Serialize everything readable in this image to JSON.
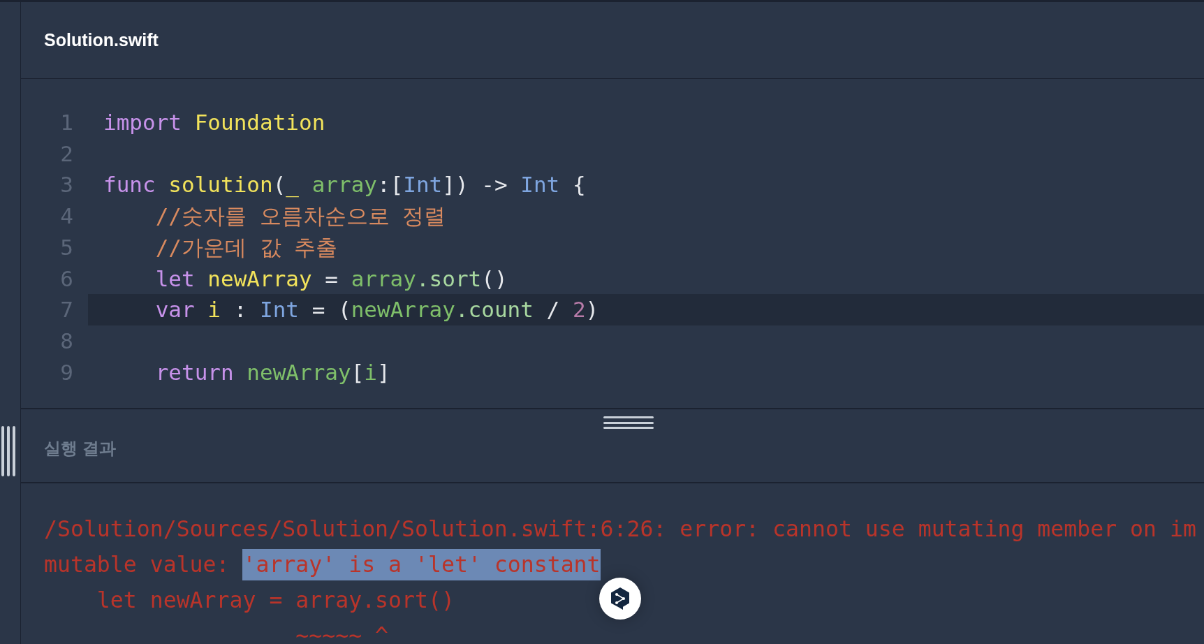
{
  "editor": {
    "file_title": "Solution.swift",
    "lines": [
      {
        "number": "1",
        "current": false,
        "tokens": [
          {
            "text": "import ",
            "kind": "keyword"
          },
          {
            "text": "Foundation",
            "kind": "name"
          }
        ]
      },
      {
        "number": "2",
        "current": false
      },
      {
        "number": "3",
        "current": false,
        "tokens": [
          {
            "text": "func ",
            "kind": "keyword"
          },
          {
            "text": "solution",
            "kind": "name"
          },
          {
            "text": "(",
            "kind": "plain"
          },
          {
            "text": "_ ",
            "kind": "name"
          },
          {
            "text": "array",
            "kind": "variable"
          },
          {
            "text": ":[",
            "kind": "plain"
          },
          {
            "text": "Int",
            "kind": "type"
          },
          {
            "text": "]) -> ",
            "kind": "plain"
          },
          {
            "text": "Int",
            "kind": "type"
          },
          {
            "text": " {",
            "kind": "plain"
          }
        ]
      },
      {
        "number": "4",
        "current": false,
        "tokens": [
          {
            "text": "    //숫자를 오름차순으로 정렬",
            "kind": "comment"
          }
        ]
      },
      {
        "number": "5",
        "current": false,
        "tokens": [
          {
            "text": "    //가운데 값 추출",
            "kind": "comment"
          }
        ]
      },
      {
        "number": "6",
        "current": false,
        "tokens": [
          {
            "text": "    let ",
            "kind": "keyword"
          },
          {
            "text": "newArray",
            "kind": "name"
          },
          {
            "text": " = ",
            "kind": "plain"
          },
          {
            "text": "array",
            "kind": "variable"
          },
          {
            "text": ".sort",
            "kind": "member"
          },
          {
            "text": "()",
            "kind": "plain"
          }
        ]
      },
      {
        "number": "7",
        "current": true,
        "tokens": [
          {
            "text": "    var ",
            "kind": "keyword"
          },
          {
            "text": "i",
            "kind": "name"
          },
          {
            "text": " : ",
            "kind": "plain"
          },
          {
            "text": "Int",
            "kind": "type"
          },
          {
            "text": " = (",
            "kind": "plain"
          },
          {
            "text": "newArray",
            "kind": "variable"
          },
          {
            "text": ".count",
            "kind": "member"
          },
          {
            "text": " / ",
            "kind": "plain"
          },
          {
            "text": "2",
            "kind": "number"
          },
          {
            "text": ")",
            "kind": "plain"
          }
        ]
      },
      {
        "number": "8",
        "current": false
      },
      {
        "number": "9",
        "current": false,
        "tokens": [
          {
            "text": "    return ",
            "kind": "keyword"
          },
          {
            "text": "newArray",
            "kind": "variable"
          },
          {
            "text": "[",
            "kind": "plain"
          },
          {
            "text": "i",
            "kind": "variable"
          },
          {
            "text": "]",
            "kind": "plain"
          }
        ]
      }
    ]
  },
  "output": {
    "title": "실행 결과",
    "lines": [
      [
        {
          "text": "/Solution/Sources/Solution/Solution.swift:6:26: error: cannot use mutating member on im",
          "selected": false
        }
      ],
      [
        {
          "text": "mutable value: ",
          "selected": false
        },
        {
          "text": "'array' is a 'let' constant",
          "selected": true
        }
      ],
      [
        {
          "text": "    let newArray = array.sort()",
          "selected": false
        }
      ],
      [
        {
          "text": "                   ~~~~~ ^",
          "selected": false
        }
      ]
    ]
  }
}
